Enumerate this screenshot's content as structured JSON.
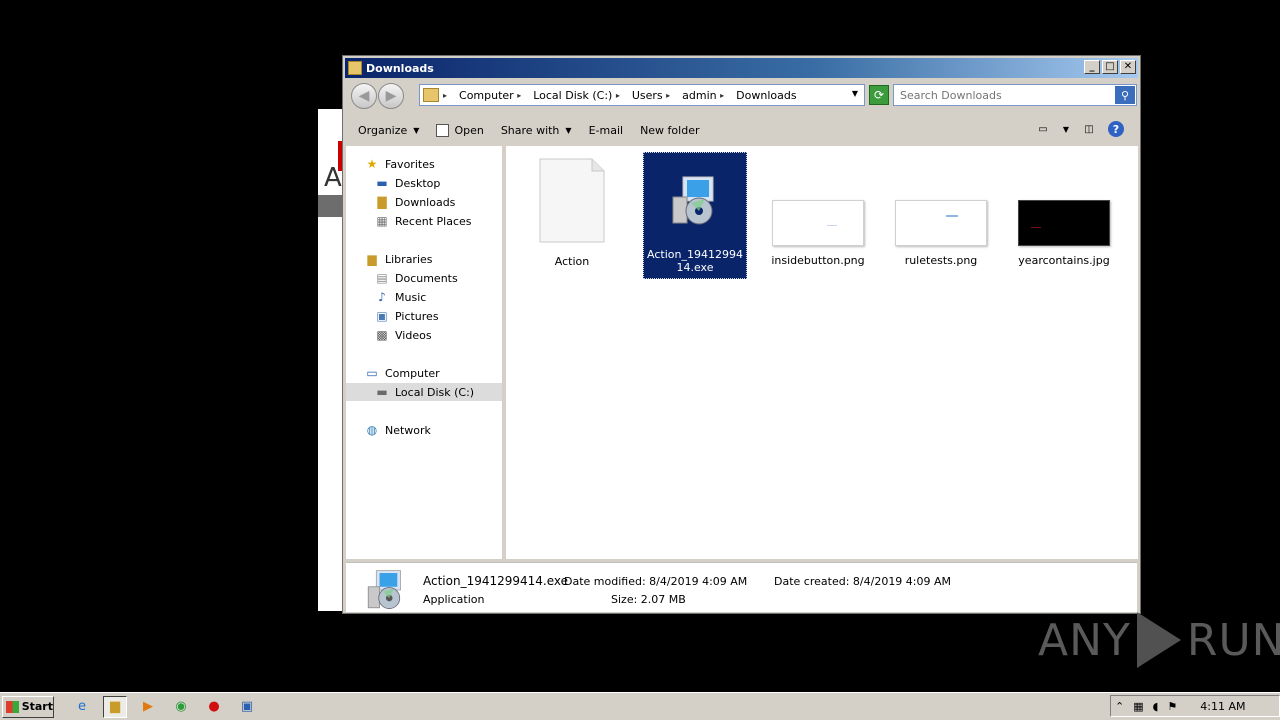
{
  "window": {
    "title": "Downloads",
    "controls": {
      "minimize": "_",
      "maximize": "□",
      "close": "✕"
    }
  },
  "address": {
    "breadcrumbs": [
      "Computer",
      "Local Disk (C:)",
      "Users",
      "admin",
      "Downloads"
    ],
    "search_placeholder": "Search Downloads"
  },
  "toolbar": {
    "organize": "Organize",
    "open": "Open",
    "share_with": "Share with",
    "email": "E-mail",
    "new_folder": "New folder"
  },
  "nav": {
    "favorites": "Favorites",
    "desktop": "Desktop",
    "downloads": "Downloads",
    "recent_places": "Recent Places",
    "libraries": "Libraries",
    "documents": "Documents",
    "music": "Music",
    "pictures": "Pictures",
    "videos": "Videos",
    "computer": "Computer",
    "local_disk": "Local Disk (C:)",
    "network": "Network"
  },
  "files": [
    {
      "name": "Action",
      "kind": "blank-document-icon"
    },
    {
      "name": "Action_1941299414.exe",
      "kind": "installer-icon",
      "selected": true
    },
    {
      "name": "insidebutton.png",
      "kind": "image-thumbnail"
    },
    {
      "name": "ruletests.png",
      "kind": "image-thumbnail"
    },
    {
      "name": "yearcontains.jpg",
      "kind": "image-thumbnail"
    }
  ],
  "details": {
    "file_name": "Action_1941299414.exe",
    "type": "Application",
    "date_modified_label": "Date modified:",
    "date_modified": "8/4/2019 4:09 AM",
    "date_created_label": "Date created:",
    "date_created": "8/4/2019 4:09 AM",
    "size_label": "Size:",
    "size": "2.07 MB"
  },
  "taskbar": {
    "start": "Start",
    "clock": "4:11 AM"
  },
  "watermark": {
    "left": "ANY",
    "right": "RUN"
  }
}
